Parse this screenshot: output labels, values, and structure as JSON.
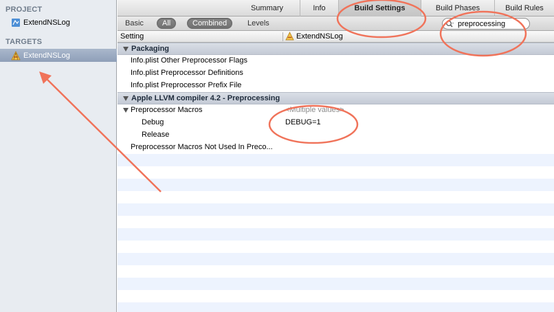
{
  "sidebar": {
    "project_heading": "PROJECT",
    "project_item": "ExtendNSLog",
    "targets_heading": "TARGETS",
    "target_item": "ExtendNSLog"
  },
  "tabs": [
    {
      "label": "Summary"
    },
    {
      "label": "Info"
    },
    {
      "label": "Build Settings",
      "active": true
    },
    {
      "label": "Build Phases"
    },
    {
      "label": "Build Rules"
    }
  ],
  "filter": {
    "basic": "Basic",
    "all": "All",
    "combined": "Combined",
    "levels": "Levels",
    "search_value": "preprocessing"
  },
  "columns": {
    "setting": "Setting",
    "target": "ExtendNSLog"
  },
  "sections": [
    {
      "title": "Packaging",
      "rows": [
        "Info.plist Other Preprocessor Flags",
        "Info.plist Preprocessor Definitions",
        "Info.plist Preprocessor Prefix File"
      ]
    },
    {
      "title": "Apple LLVM compiler 4.2 - Preprocessing",
      "macros_label": "Preprocessor Macros",
      "macros_value": "<Multiple values>",
      "debug_label": "Debug",
      "debug_value": "DEBUG=1",
      "release_label": "Release",
      "not_used_label": "Preprocessor Macros Not Used In Preco..."
    }
  ],
  "colors": {
    "annotation": "#f0735a",
    "selection": "#9aa9c2",
    "group_header": "#cfd5de"
  }
}
